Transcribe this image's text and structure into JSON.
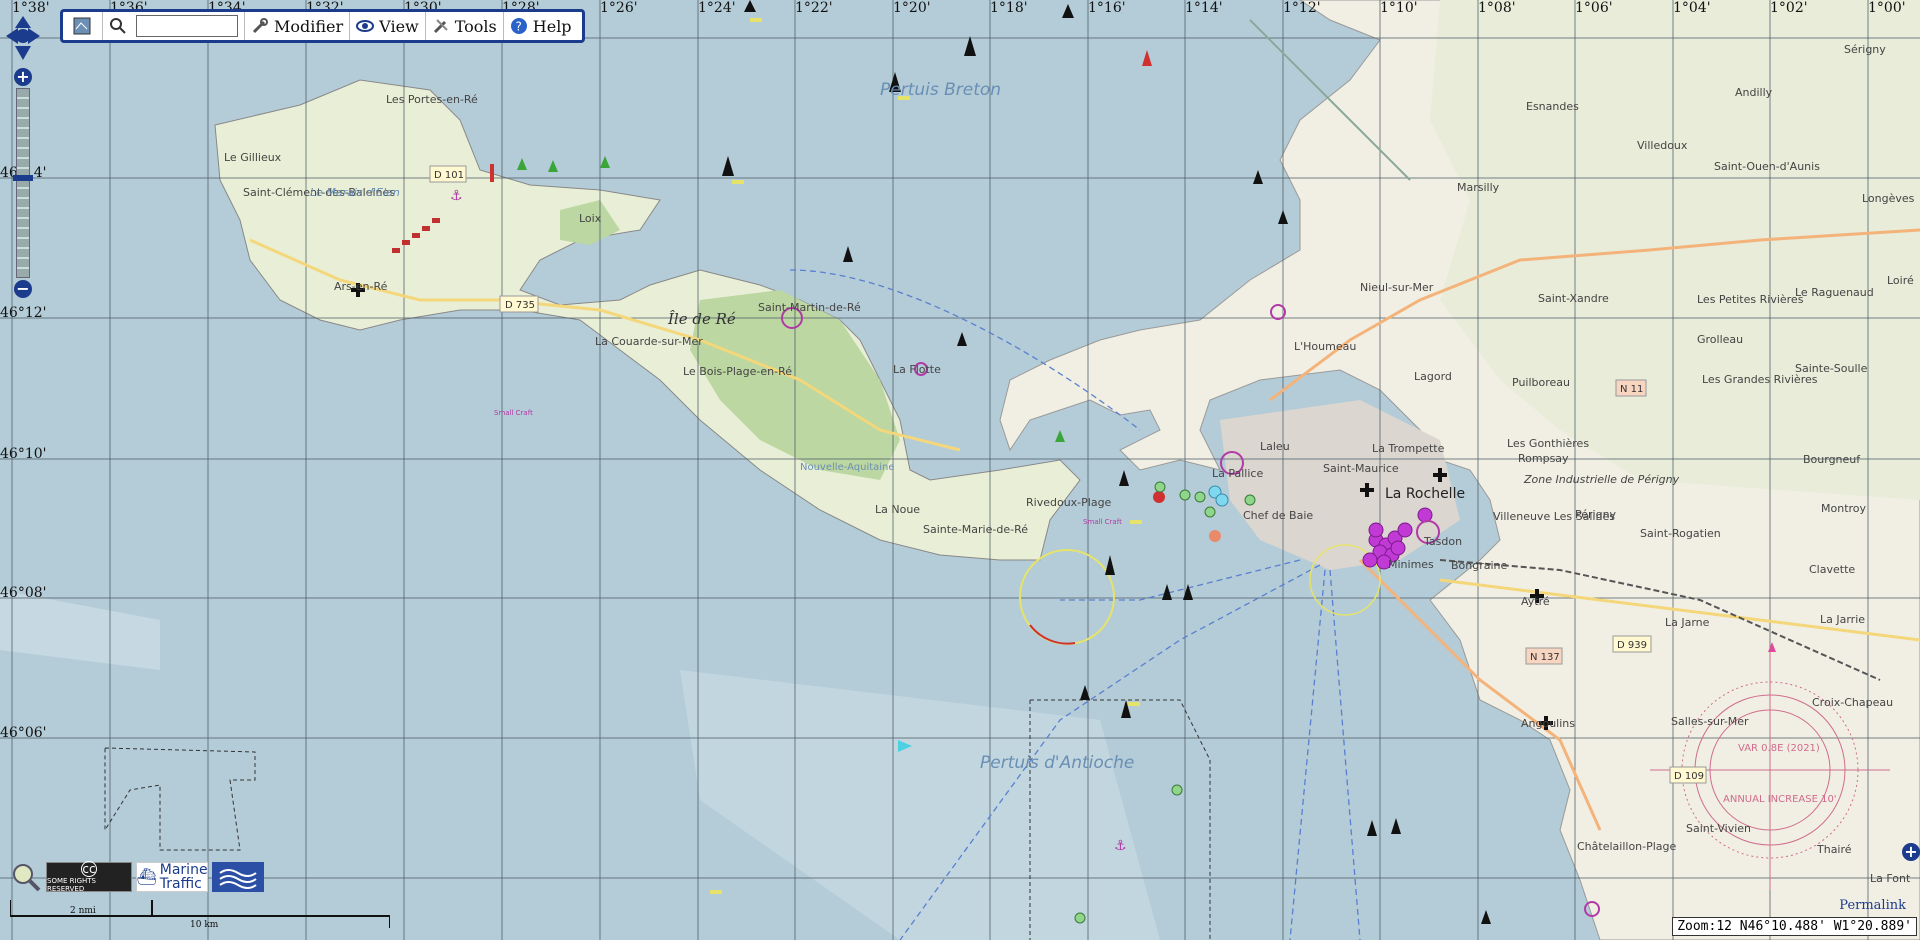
{
  "toolbar": {
    "modifier_label": "Modifier",
    "view_label": "View",
    "tools_label": "Tools",
    "help_label": "Help",
    "search_value": ""
  },
  "grid": {
    "longitudes": [
      "1°38'",
      "1°36'",
      "1°34'",
      "1°32'",
      "1°30'",
      "1°28'",
      "1°26'",
      "1°24'",
      "1°22'",
      "1°20'",
      "1°18'",
      "1°16'",
      "1°14'",
      "1°12'",
      "1°10'",
      "1°08'",
      "1°06'",
      "1°04'",
      "1°02'",
      "1°00'"
    ],
    "latitudes": [
      "46°14'",
      "46°12'",
      "46°10'",
      "46°08'",
      "46°06'"
    ]
  },
  "labels": {
    "sea_breton": "Pertuis Breton",
    "sea_antioche": "Pertuis d'Antioche",
    "island": "Île de Ré",
    "la_rochelle": "La Rochelle",
    "places": [
      "Les Portes-en-Ré",
      "Le Gillieux",
      "Saint-Clément-des-Baleines",
      "Le Marais d'Elan",
      "Loix",
      "Ars-en-Ré",
      "La Couarde-sur-Mer",
      "Le Bois-Plage-en-Ré",
      "Saint-Martin-de-Ré",
      "La Flotte",
      "La Noue",
      "Sainte-Marie-de-Ré",
      "Rivedoux-Plage",
      "La Pallice",
      "Laleu",
      "Chef de Baie",
      "Saint-Maurice",
      "La Trompette",
      "Tasdon",
      "Minimes",
      "Bongraine",
      "Aytré",
      "Angoulins",
      "Esnandes",
      "Marsilly",
      "Villedoux",
      "Sérigny",
      "Andilly",
      "Nieul-sur-Mer",
      "L'Houmeau",
      "Lagord",
      "Puilboreau",
      "Saint-Xandre",
      "Saint-Ouen-d'Aunis",
      "Les Petites Rivières",
      "Grolleau",
      "Le Raguenaud",
      "Longèves",
      "Loiré",
      "Sainte-Soulle",
      "Les Grandes Rivières",
      "Les Gonthières",
      "Rompsay",
      "Zone Industrielle de Périgny",
      "Villeneuve Les Salines",
      "Périgny",
      "Saint-Rogatien",
      "Bourgneuf",
      "Montroy",
      "Clavette",
      "La Jarne",
      "La Jarrie",
      "Croix-Chapeau",
      "Salles-sur-Mer",
      "Saint-Vivien",
      "Châtelaillon-Plage",
      "Thairé",
      "La Font",
      "Nouvelle-Aquitaine"
    ],
    "roads": [
      "D 101",
      "D 735",
      "N 11",
      "N 137",
      "D 939",
      "D 109"
    ],
    "compass_var": "VAR 0.8E (2021)",
    "compass_increase": "ANNUAL INCREASE 10'",
    "small_craft": "Small Craft"
  },
  "logos": {
    "cc": "SOME RIGHTS RESERVED",
    "marine_traffic_1": "Marine",
    "marine_traffic_2": "Traffic"
  },
  "scale": {
    "nmi": "2 nmi",
    "km": "10 km"
  },
  "permalink": "Permalink",
  "status": "Zoom:12 N46°10.488' W1°20.889'",
  "colors": {
    "sea": "#b4ccd7",
    "land": "#f1efe4",
    "forest": "#bcd7a2",
    "toolbar_border": "#1b3b8c",
    "marker_magenta": "#c23ad6"
  }
}
